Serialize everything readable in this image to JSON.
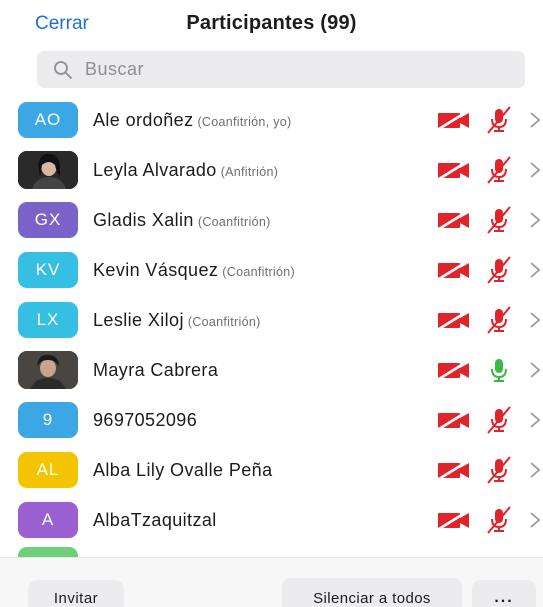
{
  "header": {
    "close_label": "Cerrar",
    "title": "Participantes (99)"
  },
  "search": {
    "placeholder": "Buscar",
    "icon": "search-icon"
  },
  "colors": {
    "accent": "#1f6fd1",
    "muted_red": "#e0242b",
    "mic_green": "#3cb84a"
  },
  "participants": [
    {
      "initials": "AO",
      "avatar_color": "#3da7e6",
      "name": "Ale ordoñez",
      "role": "(Coanfitrión, yo)",
      "video": "off",
      "audio": "muted"
    },
    {
      "initials": "",
      "avatar_color": "#2a2a2a",
      "avatar_photo": true,
      "name": "Leyla Alvarado",
      "role": "(Anfitrión)",
      "video": "off",
      "audio": "muted"
    },
    {
      "initials": "GX",
      "avatar_color": "#7b62c9",
      "name": "Gladis Xalin",
      "role": "(Coanfitrión)",
      "video": "off",
      "audio": "muted"
    },
    {
      "initials": "KV",
      "avatar_color": "#35bfe3",
      "name": "Kevin Vásquez",
      "role": "(Coanfitrión)",
      "video": "off",
      "audio": "muted"
    },
    {
      "initials": "LX",
      "avatar_color": "#35bfe3",
      "name": "Leslie Xiloj",
      "role": "(Coanfitrión)",
      "video": "off",
      "audio": "muted"
    },
    {
      "initials": "",
      "avatar_color": "#3b3b3b",
      "avatar_photo": true,
      "name": "Mayra Cabrera",
      "role": "",
      "video": "off",
      "audio": "on"
    },
    {
      "initials": "9",
      "avatar_color": "#3da7e6",
      "name": "9697052096",
      "role": "",
      "video": "off",
      "audio": "muted"
    },
    {
      "initials": "AL",
      "avatar_color": "#f5c400",
      "name": "Alba Lily Ovalle Peña",
      "role": "",
      "video": "off",
      "audio": "muted"
    },
    {
      "initials": "A",
      "avatar_color": "#9a5fd0",
      "name": "AlbaTzaquitzal",
      "role": "",
      "video": "off",
      "audio": "muted"
    }
  ],
  "partial_row": {
    "avatar_color": "#6fcf7a"
  },
  "footer": {
    "invite_label": "Invitar",
    "mute_all_label": "Silenciar a todos",
    "more_label": "..."
  }
}
